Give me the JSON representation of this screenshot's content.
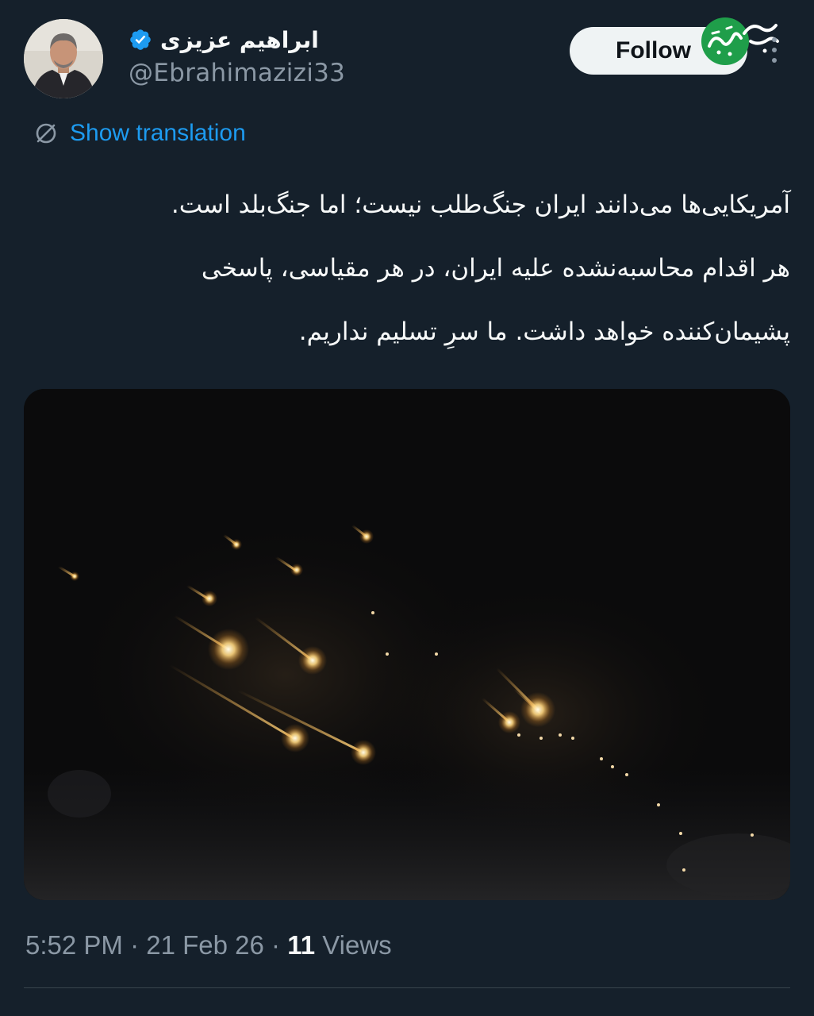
{
  "author": {
    "display_name": "ابراهیم عزیزی",
    "handle": "@Ebrahimazizi33",
    "verified": true
  },
  "follow_button": {
    "label": "Follow"
  },
  "translation": {
    "label": "Show translation",
    "icon": "translate-globe-icon"
  },
  "tweet": {
    "lines": [
      "آمریکایی‌ها می‌دانند ایران جنگ‌طلب نیست؛ اما جنگ‌بلد است.",
      "هر اقدام محاسبه‌نشده علیه ایران، در هر مقیاسی، پاسخی",
      "پشیمان‌کننده خواهد داشت. ما سرِ تسلیم نداریم."
    ]
  },
  "media": {
    "kind": "photo",
    "subject": "missile-trails-night-sky"
  },
  "meta": {
    "time": "5:52 PM",
    "separator": " · ",
    "date": "21 Feb 26",
    "views_count": "11",
    "views_label": " Views"
  },
  "colors": {
    "background": "#15202b",
    "link": "#1d9bf0",
    "secondary_text": "#8b98a5",
    "verified_badge": "#1d9bf0",
    "watermark_green": "#1f9e4a"
  }
}
